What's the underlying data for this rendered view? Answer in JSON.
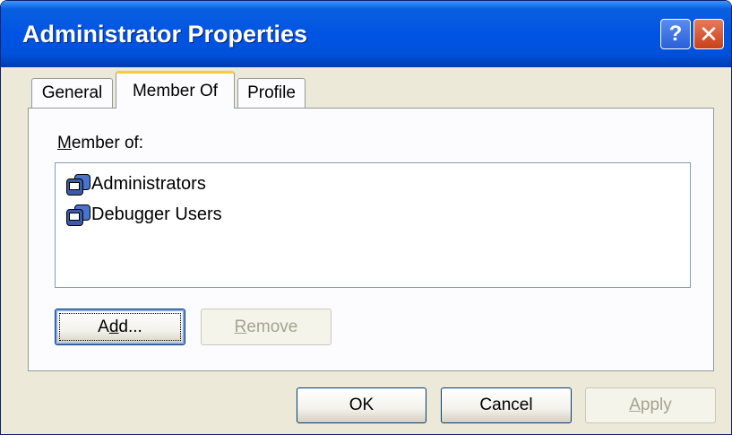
{
  "window": {
    "title": "Administrator Properties",
    "help_label": "?",
    "close_label": "✕"
  },
  "tabs": [
    {
      "label": "General",
      "selected": false
    },
    {
      "label": "Member Of",
      "selected": true
    },
    {
      "label": "Profile",
      "selected": false
    }
  ],
  "member_of": {
    "label_first": "M",
    "label_rest": "ember of:",
    "groups": [
      {
        "name": "Administrators",
        "icon": "group-icon"
      },
      {
        "name": "Debugger Users",
        "icon": "group-icon"
      }
    ]
  },
  "buttons": {
    "add": {
      "pre": "A",
      "ul": "d",
      "post": "d..."
    },
    "remove": {
      "pre": "",
      "ul": "R",
      "post": "emove"
    },
    "ok": "OK",
    "cancel": "Cancel",
    "apply": {
      "pre": "",
      "ul": "A",
      "post": "pply"
    }
  },
  "colors": {
    "title_bar": "#0054e3",
    "face": "#ece9d8",
    "selected_tab_accent": "#ffc83c"
  }
}
